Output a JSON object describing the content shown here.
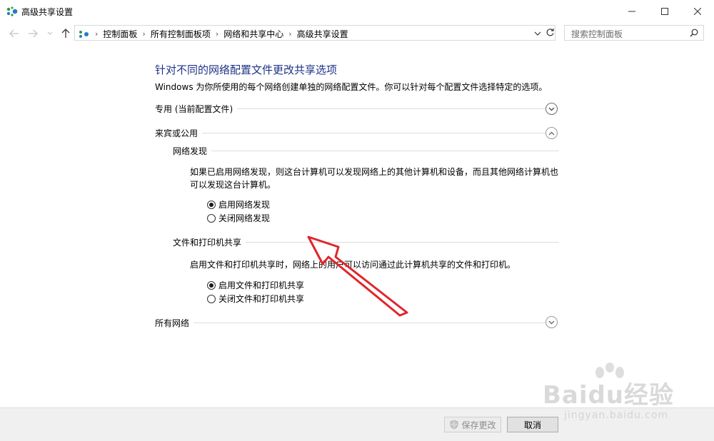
{
  "window": {
    "title": "高级共享设置",
    "minimize_icon": "minimize-icon",
    "maximize_icon": "maximize-icon",
    "close_icon": "close-icon"
  },
  "breadcrumbs": [
    "控制面板",
    "所有控制面板项",
    "网络和共享中心",
    "高级共享设置"
  ],
  "search": {
    "placeholder": "搜索控制面板"
  },
  "content": {
    "heading": "针对不同的网络配置文件更改共享选项",
    "intro": "Windows 为你所使用的每个网络创建单独的网络配置文件。你可以针对每个配置文件选择特定的选项。",
    "profiles": {
      "private_label": "专用 (当前配置文件)",
      "guest_public_label": "来宾或公用",
      "all_networks_label": "所有网络"
    },
    "network_discovery": {
      "title": "网络发现",
      "description_line1": "如果已启用网络发现，则这台计算机可以发现网络上的其他计算机和设备，而且其他网络计算机也",
      "description_line2": "可以发现这台计算机。",
      "option_on": "启用网络发现",
      "option_off": "关闭网络发现",
      "selected": "on"
    },
    "file_printer_sharing": {
      "title": "文件和打印机共享",
      "description": "启用文件和打印机共享时，网络上的用户可以访问通过此计算机共享的文件和打印机。",
      "option_on": "启用文件和打印机共享",
      "option_off": "关闭文件和打印机共享",
      "selected": "on"
    }
  },
  "footer": {
    "save_label": "保存更改",
    "cancel_label": "取消"
  },
  "watermark": {
    "text1": "Baidu经验",
    "text2": "jingyan.baidu.com"
  },
  "colors": {
    "heading": "#1e3287",
    "arrow": "#e0262b"
  }
}
